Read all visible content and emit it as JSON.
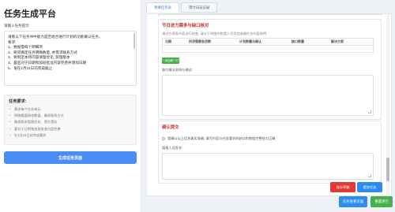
{
  "left": {
    "title": "任务生成平台",
    "input_label": "请输入任务提示:",
    "task_lines": [
      "请看以下任务书中能力是否组合进行计划的功能确认任务。",
      "要求:",
      "1、数据需每个明细项",
      "2、要同确定任务明确数量, 并需求联系方式",
      "3、要制定本场内容清理优化, 管理版本",
      "4、最后对于日期和加班批准内容完善并添加日期",
      "5、毫在1月15日前完成截止"
    ],
    "requirements_title": "任务要求:",
    "requirements": [
      "需求每个任务单元",
      "明确需要具体数值、确保联系方式",
      "确保版本管理优化、责任落实",
      "要对于日期和加班批准内容完善",
      "在1月15日前完成最终"
    ],
    "generate_button": "生成任务页面"
  },
  "tabs": [
    {
      "label": "预填任务表",
      "active": true
    },
    {
      "label": "审计日志记录",
      "active": false
    }
  ],
  "card1": {
    "title": "节日进力需多与缺口核对",
    "desc": "请对应原表内容进行检查, 请对于明细的数量人员添加准确任务内容说明",
    "columns": [
      "日期",
      "所涉需要各项数",
      "计划数量与确认",
      "缺口数量",
      "解决方案"
    ],
    "add_row": "+ 添加新一行",
    "notes_label": "缺口情况说明与建议:"
  },
  "card2": {
    "title": "确认提交",
    "confirm_text": "我确认以上信息真实准确, 填写内容与任务要求的缺口和数据完整核对正确",
    "signature_label": "填报人员签名:"
  },
  "buttons": {
    "save": "保存草稿",
    "submit": "提交任务",
    "view": "任务查看页面",
    "clear": "重置清空"
  },
  "colors": {
    "primary": "#2d8cf0",
    "danger": "#e53935",
    "success": "#46b04a",
    "title_red": "#d0322b"
  }
}
